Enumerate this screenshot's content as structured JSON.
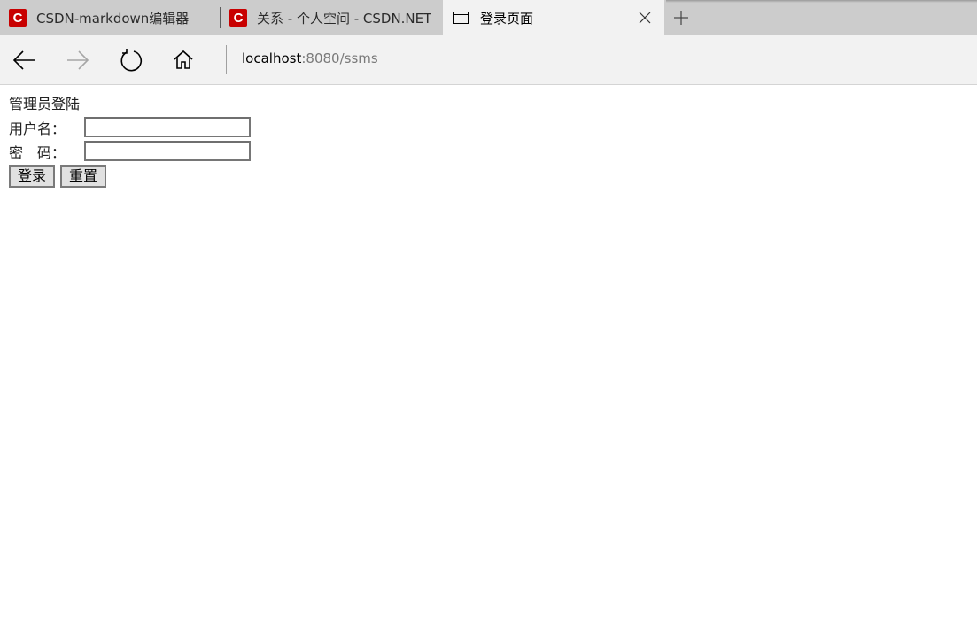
{
  "tabs": [
    {
      "title": "CSDN-markdown编辑器",
      "icon": "csdn-logo-icon",
      "favicon_letter": "C"
    },
    {
      "title": "关系 - 个人空间 - CSDN.NET",
      "icon": "csdn-logo-icon",
      "favicon_letter": "C"
    },
    {
      "title": "登录页面",
      "icon": "page-icon",
      "active": true
    }
  ],
  "address_bar": {
    "host": "localhost",
    "rest": ":8080/ssms"
  },
  "form": {
    "heading": "管理员登陆",
    "username_label": "用户名：",
    "username_value": "",
    "password_label": "密　码：",
    "password_value": "",
    "login_button": "登录",
    "reset_button": "重置"
  },
  "colors": {
    "tabbar": "#cccccc",
    "active_tab": "#f2f2f2",
    "csdn_red": "#c80000"
  }
}
